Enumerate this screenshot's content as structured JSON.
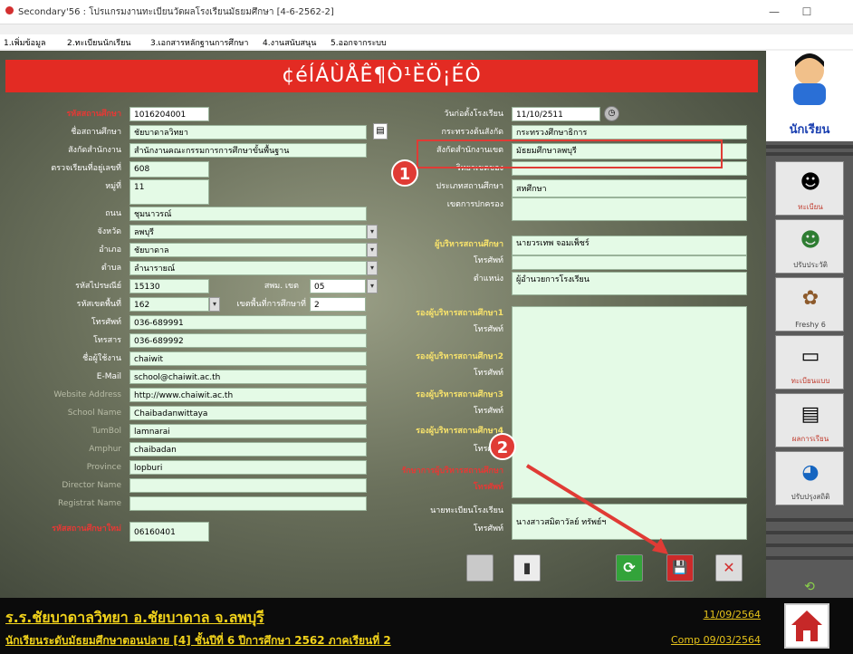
{
  "window": {
    "title": "Secondary'56 : โปรแกรมงานทะเบียนวัดผลโรงเรียนมัธยมศึกษา [4-6-2562-2]",
    "minimize": "—",
    "maximize": "☐"
  },
  "menu": [
    "1.เพิ่มข้อมูล",
    "2.ทะเบียนนักเรียน",
    "3.เอกสารหลักฐานการศึกษา",
    "4.งานสนับสนุน",
    "5.ออกจากระบบ"
  ],
  "banner": "¢éÍÁÙÅÊ¶Ò¹ÈÖ¡ÉÒ",
  "left": {
    "labels": [
      "รหัสสถานศึกษา",
      "ชื่อสถานศึกษา",
      "สังกัดสำนักงาน",
      "ตรวจเรียนที่อยู่เลขที่",
      "หมู่ที่",
      "ถนน",
      "จังหวัด",
      "อำเภอ",
      "ตำบล",
      "รหัสไปรษณีย์",
      "รหัสเขตพื้นที่",
      "โทรศัพท์",
      "โทรสาร",
      "ชื่อผู้ใช้งาน",
      "E-Mail",
      "Website Address",
      "School Name",
      "TumBol",
      "Amphur",
      "Province",
      "Director Name",
      "Registrat Name",
      "รหัสสถานศึกษาใหม่"
    ],
    "values": {
      "school_code": "1016204001",
      "school_name": "ชัยบาดาลวิทยา",
      "office": "สำนักงานคณะกรรมการการศึกษาขั้นพื้นฐาน",
      "address_no": "608",
      "moo": "11",
      "road": "ชุมนาวรณ์",
      "province": "ลพบุรี",
      "amphur": "ชัยบาดาล",
      "tambon": "ลำนารายณ์",
      "postcode": "15130",
      "area_code": "162",
      "phone": "036-689991",
      "fax": "036-689992",
      "username": "chaiwit",
      "email": "school@chaiwit.ac.th",
      "website": "http://www.chaiwit.ac.th",
      "school_name_en": "Chaibadanwittaya",
      "tumbol_en": "lamnarai",
      "amphur_en": "chaibadan",
      "province_en": "lopburi",
      "director_en": "",
      "registrar_en": "",
      "new_school_code": "06160401"
    },
    "small_labels": [
      "สพม. เขต",
      "เขตพื้นที่การศึกษาที่"
    ],
    "small_values": [
      "05",
      "2"
    ]
  },
  "right": {
    "labels": [
      "วันก่อตั้งโรงเรียน",
      "กระทรวงต้นสังกัด",
      "สังกัดสำนักงานเขต",
      "วิทยาเขตของ",
      "ประเภทสถานศึกษา",
      "เขตการปกครอง",
      "ผู้บริหารสถานศึกษา",
      "โทรศัพท์",
      "ตำแหน่ง",
      "รองผู้บริหารสถานศึกษา1",
      "โทรศัพท์",
      "รองผู้บริหารสถานศึกษา2",
      "โทรศัพท์",
      "รองผู้บริหารสถานศึกษา3",
      "โทรศัพท์",
      "รองผู้บริหารสถานศึกษา4",
      "โทรศัพท์",
      "รักษาการผู้บริหารสถานศึกษา",
      "โทรศัพท์",
      "นายทะเบียนโรงเรียน",
      "โทรศัพท์"
    ],
    "values": {
      "founded": "11/10/2511",
      "ministry": "กระทรวงศึกษาธิการ",
      "area_office": "มัธยมศึกษาลพบุรี",
      "campus": "",
      "type": "สหศึกษา",
      "district": "",
      "director": "นายวรเทพ  จอมเพ็ชร์",
      "director_phone": "",
      "position": "ผู้อำนวยการโรงเรียน",
      "registrar": "นางสาวสมิตาวัลย์ ทรัพย์ฯ"
    }
  },
  "annotations": {
    "marker1": "1",
    "marker2": "2"
  },
  "toolbar": {
    "refresh": "⟳",
    "save": "💾",
    "close": "✕",
    "doc": "▮",
    "blank": ""
  },
  "sidebar": {
    "profile_label": "นักเรียน",
    "buttons": [
      "ทะเบียน",
      "ปรับประวัติ",
      "Freshy 6",
      "ทะเบียนแบบ",
      "ผลการเรียน",
      "ปรับปรุงสถิติ"
    ]
  },
  "footer": {
    "school_line": "ร.ร.ชัยบาดาลวิทยา  อ.ชัยบาดาล  จ.ลพบุรี",
    "class_line": "นักเรียนระดับมัธยมศึกษาตอนปลาย [4]  ชั้นปีที่ 6  ปีการศึกษา 2562  ภาคเรียนที่  2",
    "date1": "11/09/2564",
    "date2": "Comp 09/03/2564"
  }
}
